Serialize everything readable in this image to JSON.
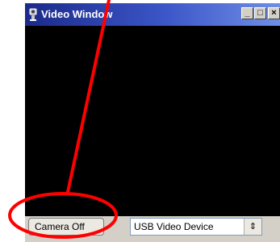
{
  "window": {
    "title": "Video Window",
    "title_icon": "camera-icon",
    "minimize_glyph": "_",
    "maximize_glyph": "□",
    "close_glyph": "×"
  },
  "controls": {
    "camera_button_label": "Camera Off",
    "device_select_value": "USB Video Device",
    "device_select_arrow": "⇕"
  },
  "annotation": {
    "color": "#ff0000",
    "shape": "ellipse-with-arrow",
    "target": "camera-off-button"
  }
}
